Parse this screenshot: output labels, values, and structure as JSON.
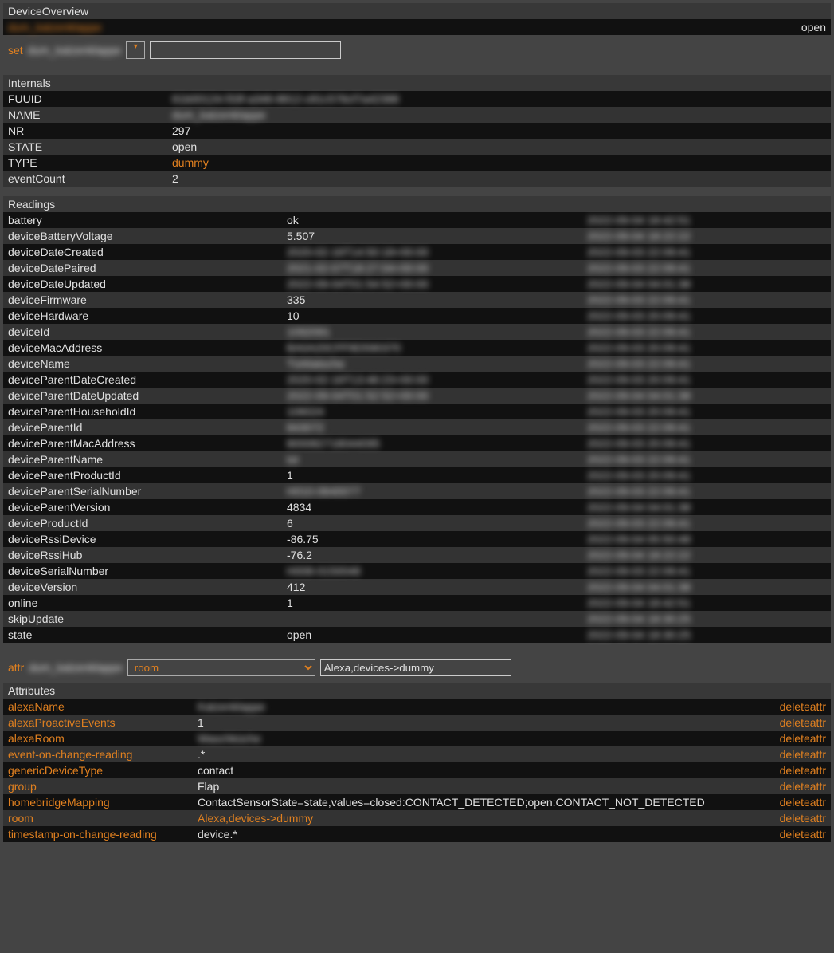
{
  "overview": {
    "title": "DeviceOverview",
    "device_name": "dum_katzenklappe",
    "state": "open"
  },
  "set": {
    "label": "set",
    "device": "dum_katzenklappe",
    "dropdown_glyph": "▾",
    "value": ""
  },
  "internals": {
    "title": "Internals",
    "rows": [
      {
        "k": "FUUID",
        "v": "61b00124-f33f-a346-8812-c81c576cf7a42388",
        "blur": true
      },
      {
        "k": "NAME",
        "v": "dum_katzenklappe",
        "blur": true
      },
      {
        "k": "NR",
        "v": "297"
      },
      {
        "k": "STATE",
        "v": "open"
      },
      {
        "k": "TYPE",
        "v": "dummy",
        "accent": true
      },
      {
        "k": "eventCount",
        "v": "2"
      }
    ]
  },
  "readings": {
    "title": "Readings",
    "rows": [
      {
        "k": "battery",
        "v": "ok",
        "t": "2022-09-04 18:42:51"
      },
      {
        "k": "deviceBatteryVoltage",
        "v": "5.507",
        "t": "2022-09-04 18:22:22"
      },
      {
        "k": "deviceDateCreated",
        "v": "2020-02-16T14:50:18+00:00",
        "t": "2022-09-03 22:09:41",
        "blurv": true
      },
      {
        "k": "deviceDatePaired",
        "v": "2021-02-07T18:27:04+00:00",
        "t": "2022-09-03 22:09:41",
        "blurv": true
      },
      {
        "k": "deviceDateUpdated",
        "v": "2022-09-04T01:54:52+00:00",
        "t": "2022-09-04 04:01:38",
        "blurv": true
      },
      {
        "k": "deviceFirmware",
        "v": "335",
        "t": "2022-09-03 22:09:41"
      },
      {
        "k": "deviceHardware",
        "v": "10",
        "t": "2022-09-03 20:09:41"
      },
      {
        "k": "deviceId",
        "v": "1092091",
        "t": "2022-09-03 22:09:41",
        "blurv": true
      },
      {
        "k": "deviceMacAddress",
        "v": "BA0A20CFF8D590370",
        "t": "2022-09-03 20:09:41",
        "blurv": true
      },
      {
        "k": "deviceName",
        "v": "Türklatsche",
        "t": "2022-09-03 22:09:41",
        "blurv": true
      },
      {
        "k": "deviceParentDateCreated",
        "v": "2020-02-16T13:48:23+00:00",
        "t": "2022-09-03 20:09:41",
        "blurv": true
      },
      {
        "k": "deviceParentDateUpdated",
        "v": "2022-09-04T01:52:52+00:00",
        "t": "2022-09-04 04:01:38",
        "blurv": true
      },
      {
        "k": "deviceParentHouseholdId",
        "v": "106024",
        "t": "2022-09-03 20:09:41",
        "blurv": true
      },
      {
        "k": "deviceParentId",
        "v": "843072",
        "t": "2022-09-03 22:09:41",
        "blurv": true
      },
      {
        "k": "deviceParentMacAddress",
        "v": "800082718044095",
        "t": "2022-09-03 20:09:41",
        "blurv": true
      },
      {
        "k": "deviceParentName",
        "v": "txt",
        "t": "2022-09-03 22:09:41",
        "blurv": true
      },
      {
        "k": "deviceParentProductId",
        "v": "1",
        "t": "2022-09-03 20:09:41"
      },
      {
        "k": "deviceParentSerialNumber",
        "v": "H010-0640077",
        "t": "2022-09-03 22:09:41",
        "blurv": true
      },
      {
        "k": "deviceParentVersion",
        "v": "4834",
        "t": "2022-09-04 04:01:38"
      },
      {
        "k": "deviceProductId",
        "v": "6",
        "t": "2022-09-03 22:09:41"
      },
      {
        "k": "deviceRssiDevice",
        "v": "-86.75",
        "t": "2022-09-04 05:50:48"
      },
      {
        "k": "deviceRssiHub",
        "v": "-76.2",
        "t": "2022-09-04 18:22:22"
      },
      {
        "k": "deviceSerialNumber",
        "v": "H008-0150048",
        "t": "2022-09-03 22:09:41",
        "blurv": true
      },
      {
        "k": "deviceVersion",
        "v": "412",
        "t": "2022-09-04 04:01:38"
      },
      {
        "k": "online",
        "v": "1",
        "t": "2022-09-04 18:42:51"
      },
      {
        "k": "skipUpdate",
        "v": "",
        "t": "2022-09-04 18:30:25"
      },
      {
        "k": "state",
        "v": "open",
        "t": "2022-09-04 18:30:25"
      }
    ]
  },
  "attr": {
    "label": "attr",
    "device": "dum_katzenklappe",
    "select_value": "room",
    "input_value": "Alexa,devices->dummy"
  },
  "attributes": {
    "title": "Attributes",
    "delete_label": "deleteattr",
    "rows": [
      {
        "k": "alexaName",
        "v": "Katzenklappe",
        "accent_k": true,
        "blurv": true
      },
      {
        "k": "alexaProactiveEvents",
        "v": "1",
        "accent_k": true
      },
      {
        "k": "alexaRoom",
        "v": "Waschküche",
        "accent_k": true,
        "blurv": true
      },
      {
        "k": "event-on-change-reading",
        "v": ".*",
        "accent_k": true
      },
      {
        "k": "genericDeviceType",
        "v": "contact",
        "accent_k": true
      },
      {
        "k": "group",
        "v": "Flap",
        "accent_k": true
      },
      {
        "k": "homebridgeMapping",
        "v": "ContactSensorState=state,values=closed:CONTACT_DETECTED;open:CONTACT_NOT_DETECTED",
        "accent_k": true
      },
      {
        "k": "room",
        "v": "Alexa,devices->dummy",
        "accent_k": true,
        "accent_v": true
      },
      {
        "k": "timestamp-on-change-reading",
        "v": "device.*",
        "accent_k": true
      }
    ]
  }
}
